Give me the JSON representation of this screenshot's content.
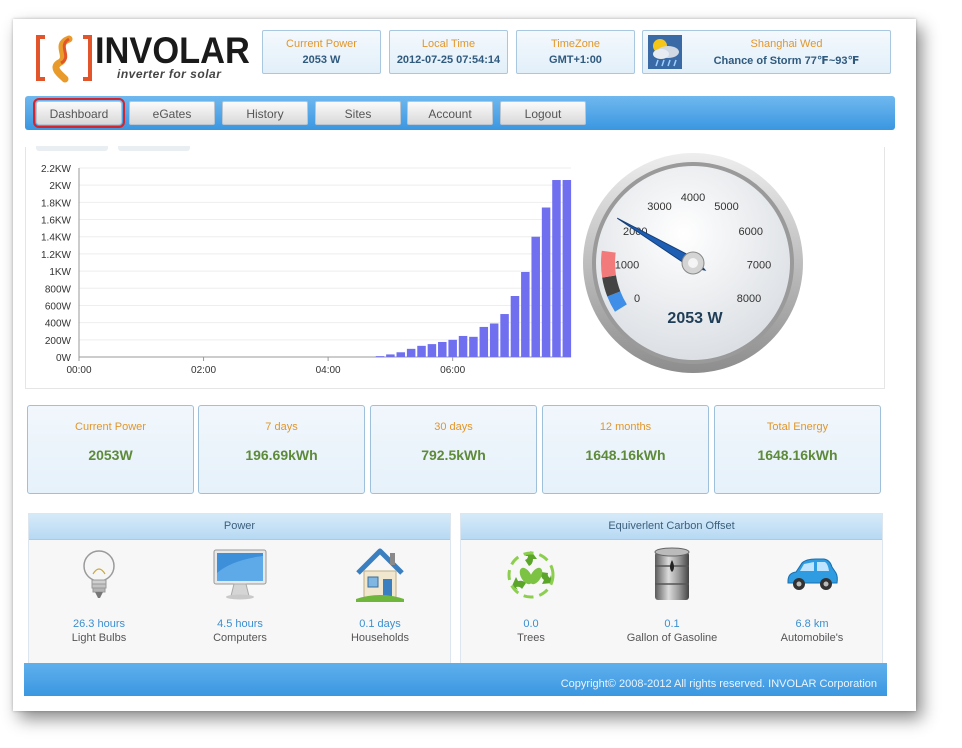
{
  "brand": {
    "name": "INVOLAR",
    "tagline": "inverter for solar"
  },
  "header": {
    "current_power": {
      "label": "Current Power",
      "value": "2053 W"
    },
    "local_time": {
      "label": "Local Time",
      "value": "2012-07-25 07:54:14"
    },
    "timezone": {
      "label": "TimeZone",
      "value": "GMT+1:00"
    },
    "weather": {
      "label": "Shanghai Wed",
      "value": "Chance of Storm 77℉~93℉",
      "icon": "storm-weather-icon"
    }
  },
  "nav": {
    "items": [
      {
        "label": "Dashboard",
        "active": true
      },
      {
        "label": "eGates"
      },
      {
        "label": "History"
      },
      {
        "label": "Sites"
      },
      {
        "label": "Account"
      },
      {
        "label": "Logout"
      }
    ]
  },
  "chart_data": {
    "type": "bar",
    "y_tick_labels": [
      "0W",
      "200W",
      "400W",
      "600W",
      "800W",
      "1KW",
      "1.2KW",
      "1.4KW",
      "1.6KW",
      "1.8KW",
      "2KW",
      "2.2KW"
    ],
    "x_tick_labels": [
      "00:00",
      "02:00",
      "04:00",
      "06:00"
    ],
    "ylim": [
      0,
      2200
    ],
    "xlim_hours": [
      0,
      7.9
    ],
    "bar_color": "#6f6ff0",
    "series": [
      {
        "x": [
          "04:50",
          "05:00",
          "05:10",
          "05:20",
          "05:30",
          "05:40",
          "05:50",
          "06:00",
          "06:10",
          "06:20",
          "06:30",
          "06:40",
          "06:50",
          "07:00",
          "07:10",
          "07:20",
          "07:30",
          "07:40",
          "07:50"
        ],
        "values": [
          10,
          30,
          55,
          95,
          130,
          150,
          175,
          200,
          245,
          235,
          350,
          390,
          500,
          710,
          990,
          1400,
          1740,
          2060,
          2060
        ]
      }
    ]
  },
  "gauge": {
    "value": 2053,
    "unit": "W",
    "readout": "2053 W",
    "min": 0,
    "max": 8000,
    "ticks": [
      "0",
      "1000",
      "2000",
      "3000",
      "4000",
      "5000",
      "6000",
      "7000",
      "8000"
    ]
  },
  "stats": [
    {
      "label": "Current Power",
      "value": "2053W"
    },
    {
      "label": "7 days",
      "value": "196.69kWh"
    },
    {
      "label": "30 days",
      "value": "792.5kWh"
    },
    {
      "label": "12 months",
      "value": "1648.16kWh"
    },
    {
      "label": "Total Energy",
      "value": "1648.16kWh"
    }
  ],
  "power_panel": {
    "title": "Power",
    "items": [
      {
        "value": "26.3 hours",
        "label": "Light Bulbs",
        "icon": "light-bulb-icon"
      },
      {
        "value": "4.5 hours",
        "label": "Computers",
        "icon": "computer-icon"
      },
      {
        "value": "0.1 days",
        "label": "Households",
        "icon": "house-icon"
      }
    ]
  },
  "carbon_panel": {
    "title": "Equiverlent Carbon Offset",
    "items": [
      {
        "value": "0.0",
        "label": "Trees",
        "icon": "recycle-leaves-icon"
      },
      {
        "value": "0.1",
        "label": "Gallon of Gasoline",
        "icon": "oil-barrel-icon"
      },
      {
        "value": "6.8 km",
        "label": "Automobile's",
        "icon": "car-icon"
      }
    ]
  },
  "footer": {
    "text": "Copyright© 2008-2012 All rights reserved. INVOLAR Corporation"
  },
  "colors": {
    "accent_blue": "#3b97e1",
    "orange_label": "#e2962a",
    "green_value": "#5e8a3a",
    "active_outline": "#d4252c"
  }
}
